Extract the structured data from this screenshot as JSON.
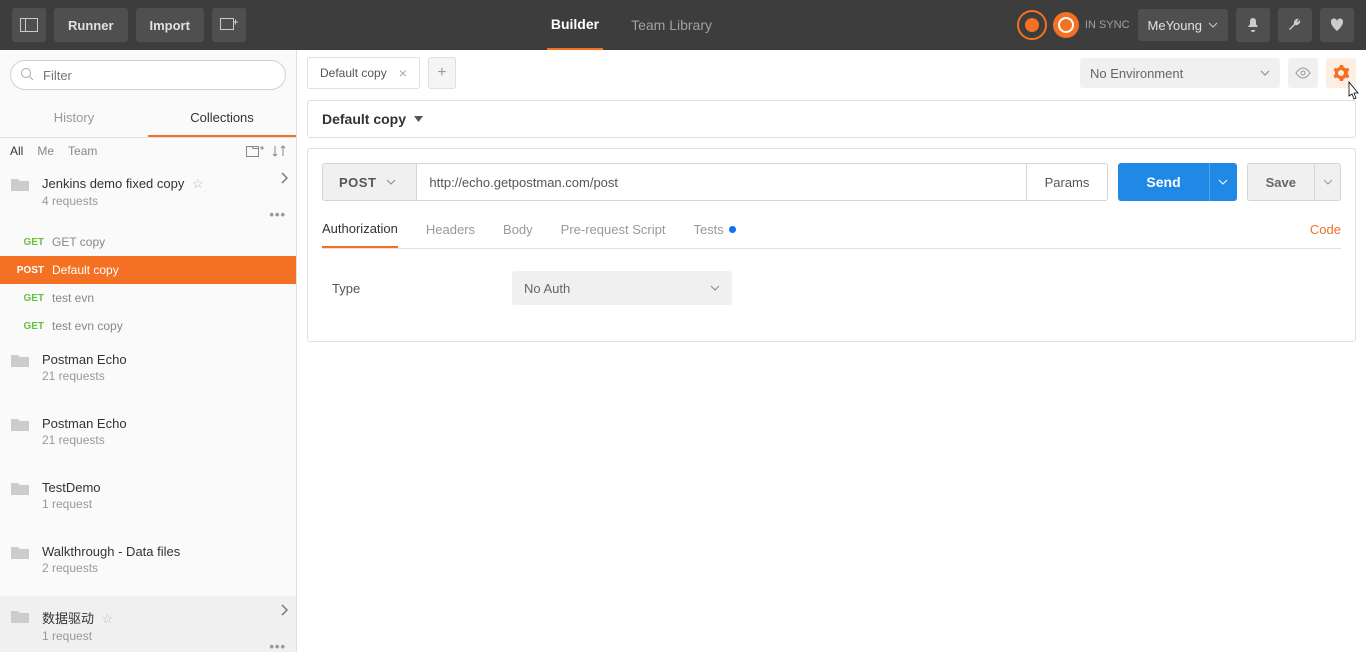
{
  "topbar": {
    "runner": "Runner",
    "import": "Import",
    "builder_tab": "Builder",
    "team_library_tab": "Team Library",
    "sync_status": "IN SYNC",
    "username": "MeYoung"
  },
  "sidebar": {
    "filter_placeholder": "Filter",
    "tabs": {
      "history": "History",
      "collections": "Collections"
    },
    "filters": {
      "all": "All",
      "me": "Me",
      "team": "Team"
    },
    "collections": [
      {
        "name": "Jenkins demo fixed copy",
        "count": "4 requests",
        "starred": true,
        "expanded": true,
        "more": true
      },
      {
        "name": "Postman Echo",
        "count": "21 requests"
      },
      {
        "name": "Postman Echo",
        "count": "21 requests"
      },
      {
        "name": "TestDemo",
        "count": "1 request"
      },
      {
        "name": "Walkthrough - Data files",
        "count": "2 requests"
      },
      {
        "name": "数据驱动",
        "count": "1 request",
        "starred": true,
        "expanded": false,
        "more": true
      }
    ],
    "requests": [
      {
        "method": "GET",
        "name": "GET copy"
      },
      {
        "method": "POST",
        "name": "Default copy",
        "active": true
      },
      {
        "method": "GET",
        "name": "test evn"
      },
      {
        "method": "GET",
        "name": "test evn copy"
      }
    ]
  },
  "content": {
    "tab_name": "Default copy",
    "environment": "No Environment",
    "request_name": "Default copy",
    "method": "POST",
    "url": "http://echo.getpostman.com/post",
    "params_btn": "Params",
    "send_btn": "Send",
    "save_btn": "Save",
    "section_tabs": {
      "authorization": "Authorization",
      "headers": "Headers",
      "body": "Body",
      "prerequest": "Pre-request Script",
      "tests": "Tests"
    },
    "code_link": "Code",
    "auth": {
      "type_label": "Type",
      "type_value": "No Auth"
    }
  }
}
